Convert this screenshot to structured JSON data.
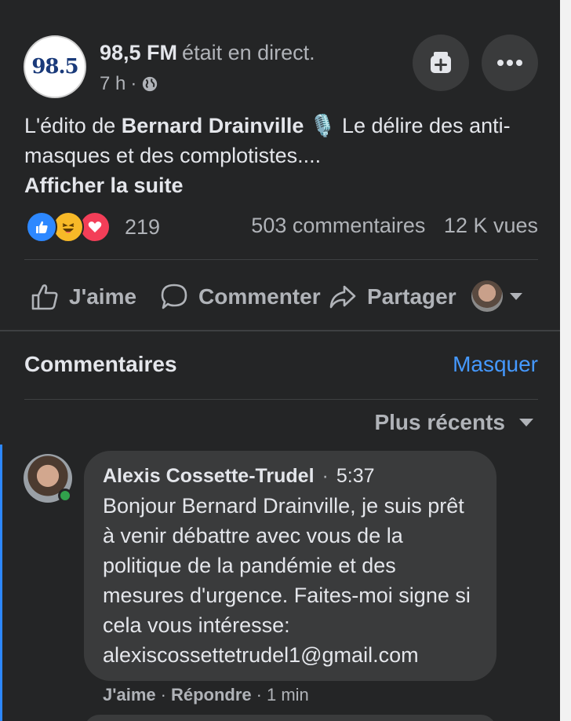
{
  "post": {
    "page_name": "98,5 FM",
    "status": "était en direct.",
    "time": "7 h",
    "dot": "·",
    "logo_text": "98.5",
    "text_prefix": "L'édito de ",
    "text_bold": "Bernard Drainville",
    "text_rest": " 🎙️ Le délire des anti-masques et des complotistes....",
    "see_more": "Afficher la suite",
    "reaction_count": "219",
    "comments_count": "503 commentaires",
    "views": "12 K vues",
    "reactions": [
      "like-icon",
      "haha-icon",
      "love-icon"
    ]
  },
  "actions": {
    "like": "J'aime",
    "comment": "Commenter",
    "share": "Partager"
  },
  "comments_section": {
    "title": "Commentaires",
    "hide": "Masquer",
    "sort": "Plus récents"
  },
  "comment": {
    "author": "Alexis Cossette-Trudel",
    "dot": "·",
    "time": "5:37",
    "body": "Bonjour Bernard Drainville, je suis prêt à venir débattre avec vous de la politique de la pandémie et des mesures d'urgence. Faites-moi signe si cela vous intéresse: alexiscossettetrudel1@gmail.com",
    "like": "J'aime",
    "reply": "Répondre",
    "age": "1 min",
    "dot2": "·"
  },
  "colors": {
    "background": "#242526",
    "bubble": "#3a3b3c",
    "accent": "#4599ff",
    "online": "#31a24c"
  }
}
